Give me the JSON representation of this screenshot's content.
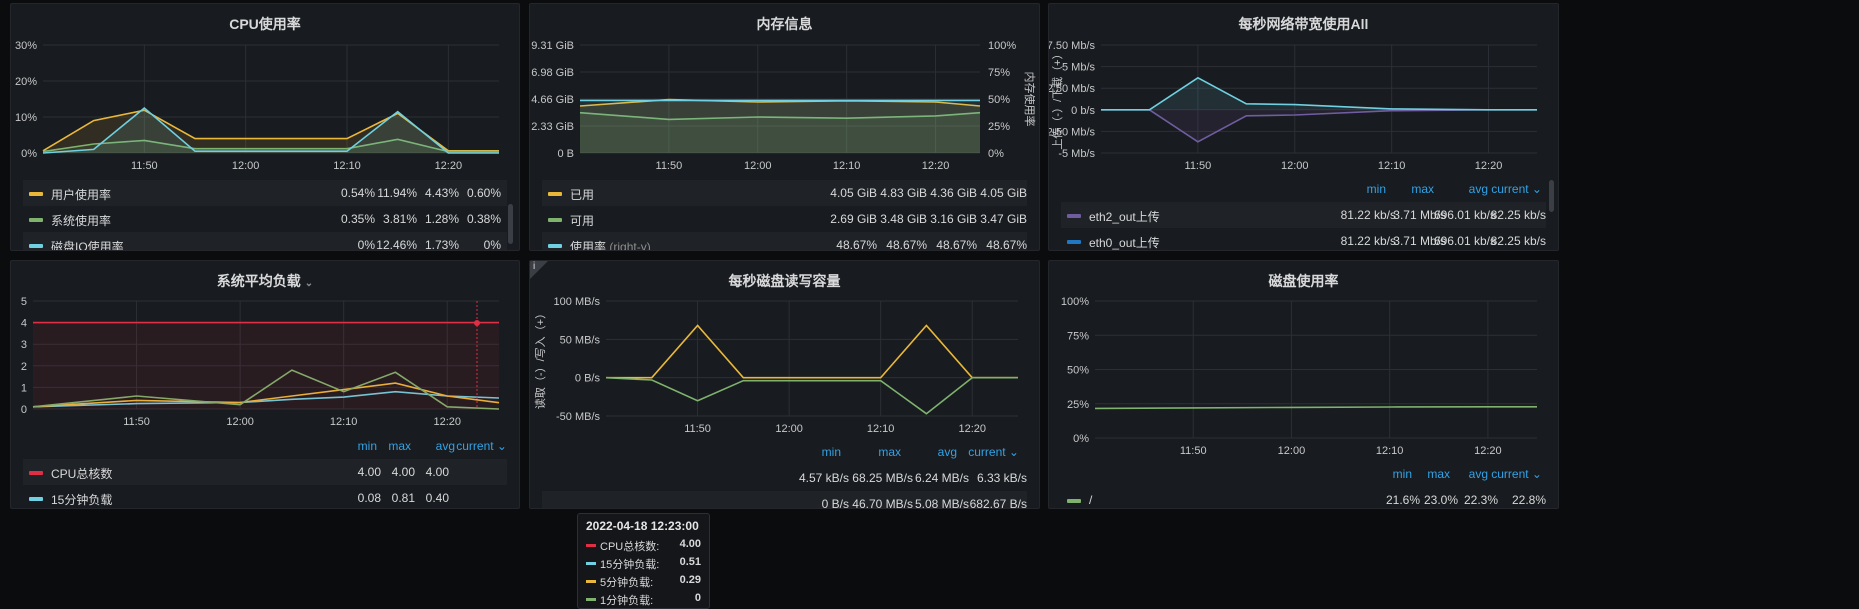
{
  "colors": {
    "red": "#e02f44",
    "yellow": "#eab839",
    "green": "#7eb26d",
    "cyan": "#6ed0e0",
    "blue": "#1f78c1",
    "purple": "#705da0",
    "accent": "#33a2e5"
  },
  "stat_headers": {
    "min": "min",
    "max": "max",
    "avg": "avg",
    "current": "current ⌄"
  },
  "panels": {
    "cpu": {
      "title": "CPU使用率",
      "yticks": [
        "30%",
        "20%",
        "10%",
        "0%"
      ],
      "xticks": [
        "11:50",
        "12:00",
        "12:10",
        "12:20"
      ],
      "legend": [
        {
          "name": "用户使用率",
          "color": "yellow",
          "min": "0.54%",
          "max": "11.94%",
          "avg": "4.43%",
          "current": "0.60%"
        },
        {
          "name": "系统使用率",
          "color": "green",
          "min": "0.35%",
          "max": "3.81%",
          "avg": "1.28%",
          "current": "0.38%"
        },
        {
          "name": "磁盘IO使用率",
          "color": "cyan",
          "min": "0%",
          "max": "12.46%",
          "avg": "1.73%",
          "current": "0%"
        }
      ]
    },
    "mem": {
      "title": "内存信息",
      "yticks": [
        "9.31 GiB",
        "6.98 GiB",
        "4.66 GiB",
        "2.33 GiB",
        "0 B"
      ],
      "yticks_right": [
        "100%",
        "75%",
        "50%",
        "25%",
        "0%"
      ],
      "right_axis_label": "内存使用率",
      "xticks": [
        "11:50",
        "12:00",
        "12:10",
        "12:20"
      ],
      "legend": [
        {
          "name": "已用",
          "color": "yellow",
          "min": "4.05 GiB",
          "max": "4.83 GiB",
          "avg": "4.36 GiB",
          "current": "4.05 GiB"
        },
        {
          "name": "可用",
          "color": "green",
          "min": "2.69 GiB",
          "max": "3.48 GiB",
          "avg": "3.16 GiB",
          "current": "3.47 GiB"
        },
        {
          "name": "使用率",
          "suffix": "(right-y)",
          "color": "cyan",
          "min": "48.67%",
          "max": "48.67%",
          "avg": "48.67%",
          "current": "48.67%"
        }
      ]
    },
    "net": {
      "title": "每秒网络带宽使用All",
      "yticks": [
        "7.50 Mb/s",
        "5 Mb/s",
        "2.50 Mb/s",
        "0 b/s",
        "-2.50 Mb/s",
        "-5 Mb/s"
      ],
      "ylabel": "上传（-）/下载（+）",
      "xticks": [
        "11:50",
        "12:00",
        "12:10",
        "12:20"
      ],
      "legend": [
        {
          "name": "eth2_out上传",
          "color": "purple",
          "min": "81.22 kb/s",
          "max": "3.71 Mb/s",
          "avg": "696.01 kb/s",
          "current": "82.25 kb/s"
        },
        {
          "name": "eth0_out上传",
          "color": "blue",
          "min": "81.22 kb/s",
          "max": "3.71 Mb/s",
          "avg": "696.01 kb/s",
          "current": "82.25 kb/s"
        }
      ]
    },
    "load": {
      "title": "系统平均负载",
      "yticks": [
        "5",
        "4",
        "3",
        "2",
        "1",
        "0"
      ],
      "xticks": [
        "11:50",
        "12:00",
        "12:10",
        "12:20"
      ],
      "legend": [
        {
          "name": "CPU总核数",
          "color": "red",
          "min": "4.00",
          "max": "4.00",
          "avg": "4.00"
        },
        {
          "name": "15分钟负载",
          "color": "cyan",
          "min": "0.08",
          "max": "0.81",
          "avg": "0.40"
        }
      ]
    },
    "disk_io": {
      "title": "每秒磁盘读写容量",
      "yticks": [
        "100 MB/s",
        "50 MB/s",
        "0 B/s",
        "-50 MB/s"
      ],
      "ylabel": "读取（-）/写入（+）",
      "xticks": [
        "11:50",
        "12:00",
        "12:10",
        "12:20"
      ],
      "legend": [
        {
          "min": "4.57 kB/s",
          "max": "68.25 MB/s",
          "avg": "6.24 MB/s",
          "current": "6.33 kB/s"
        },
        {
          "min": "0 B/s",
          "max": "46.70 MB/s",
          "avg": "5.08 MB/s",
          "current": "682.67 B/s"
        }
      ]
    },
    "disk_usage": {
      "title": "磁盘使用率",
      "yticks": [
        "100%",
        "75%",
        "50%",
        "25%",
        "0%"
      ],
      "xticks": [
        "11:50",
        "12:00",
        "12:10",
        "12:20"
      ],
      "legend": [
        {
          "name": "/",
          "color": "green",
          "min": "21.6%",
          "max": "23.0%",
          "avg": "22.3%",
          "current": "22.8%"
        }
      ]
    }
  },
  "tooltip": {
    "time": "2022-04-18 12:23:00",
    "rows": [
      {
        "label": "CPU总核数:",
        "value": "4.00",
        "color": "red"
      },
      {
        "label": "15分钟负载:",
        "value": "0.51",
        "color": "cyan"
      },
      {
        "label": "5分钟负载:",
        "value": "0.29",
        "color": "yellow"
      },
      {
        "label": "1分钟负载:",
        "value": "0",
        "color": "green"
      }
    ]
  },
  "chart_data": [
    {
      "type": "line",
      "title": "CPU使用率",
      "ylim": [
        0,
        30
      ],
      "x": [
        "11:40",
        "11:45",
        "11:50",
        "11:55",
        "12:00",
        "12:05",
        "12:10",
        "12:15",
        "12:20",
        "12:25"
      ],
      "series": [
        {
          "name": "用户使用率",
          "values": [
            0.6,
            9,
            11.9,
            4,
            4,
            4,
            4,
            11,
            0.6,
            0.6
          ]
        },
        {
          "name": "系统使用率",
          "values": [
            0.4,
            2.5,
            3.5,
            1.2,
            1.2,
            1.2,
            1.2,
            3.8,
            0.4,
            0.4
          ]
        },
        {
          "name": "磁盘IO使用率",
          "values": [
            0,
            1,
            12.5,
            0.5,
            0.5,
            0.5,
            0.5,
            11.5,
            0,
            0
          ]
        }
      ]
    },
    {
      "type": "line",
      "title": "内存信息",
      "ylim": [
        0,
        9.31
      ],
      "x": [
        "11:40",
        "11:50",
        "12:00",
        "12:10",
        "12:20",
        "12:25"
      ],
      "series": [
        {
          "name": "已用",
          "values": [
            4.05,
            4.6,
            4.4,
            4.5,
            4.4,
            4.05
          ]
        },
        {
          "name": "可用",
          "values": [
            3.47,
            2.9,
            3.1,
            3.0,
            3.2,
            3.47
          ]
        },
        {
          "name": "使用率",
          "values": [
            48.67,
            48.67,
            48.67,
            48.67,
            48.67,
            48.67
          ]
        }
      ]
    },
    {
      "type": "area",
      "title": "每秒网络带宽使用All",
      "ylim": [
        -5,
        7.5
      ],
      "x": [
        "11:40",
        "11:45",
        "11:50",
        "11:55",
        "12:00",
        "12:10",
        "12:20",
        "12:25"
      ],
      "series": [
        {
          "name": "eth2_out上传",
          "values": [
            0,
            0,
            -3.7,
            -0.7,
            -0.6,
            -0.1,
            0,
            0
          ]
        },
        {
          "name": "eth0_out上传",
          "values": [
            0,
            0,
            3.7,
            0.7,
            0.6,
            0.1,
            0,
            0
          ]
        }
      ]
    },
    {
      "type": "line",
      "title": "系统平均负载",
      "ylim": [
        0,
        5
      ],
      "x": [
        "11:40",
        "11:50",
        "12:00",
        "12:05",
        "12:10",
        "12:15",
        "12:20",
        "12:25"
      ],
      "series": [
        {
          "name": "CPU总核数",
          "values": [
            4,
            4,
            4,
            4,
            4,
            4,
            4,
            4
          ]
        },
        {
          "name": "15分钟负载",
          "values": [
            0.1,
            0.25,
            0.3,
            0.45,
            0.55,
            0.8,
            0.6,
            0.51
          ]
        },
        {
          "name": "5分钟负载",
          "values": [
            0.1,
            0.4,
            0.3,
            0.6,
            0.9,
            1.2,
            0.6,
            0.29
          ]
        },
        {
          "name": "1分钟负载",
          "values": [
            0.1,
            0.6,
            0.2,
            1.8,
            0.8,
            1.7,
            0.1,
            0
          ]
        }
      ]
    },
    {
      "type": "line",
      "title": "每秒磁盘读写容量",
      "ylim": [
        -50,
        100
      ],
      "x": [
        "11:40",
        "11:45",
        "11:50",
        "11:55",
        "12:00",
        "12:05",
        "12:10",
        "12:15",
        "12:20",
        "12:25"
      ],
      "series": [
        {
          "values": [
            0,
            0,
            68,
            0,
            0,
            0,
            0,
            68,
            0,
            0
          ]
        },
        {
          "values": [
            0,
            -3,
            -30,
            -4,
            -4,
            -4,
            -4,
            -47,
            0,
            0
          ]
        }
      ]
    },
    {
      "type": "line",
      "title": "磁盘使用率",
      "ylim": [
        0,
        100
      ],
      "x": [
        "11:40",
        "11:50",
        "12:00",
        "12:10",
        "12:20",
        "12:25"
      ],
      "series": [
        {
          "name": "/",
          "values": [
            21.6,
            22.0,
            22.3,
            22.6,
            22.8,
            22.8
          ]
        }
      ]
    }
  ]
}
